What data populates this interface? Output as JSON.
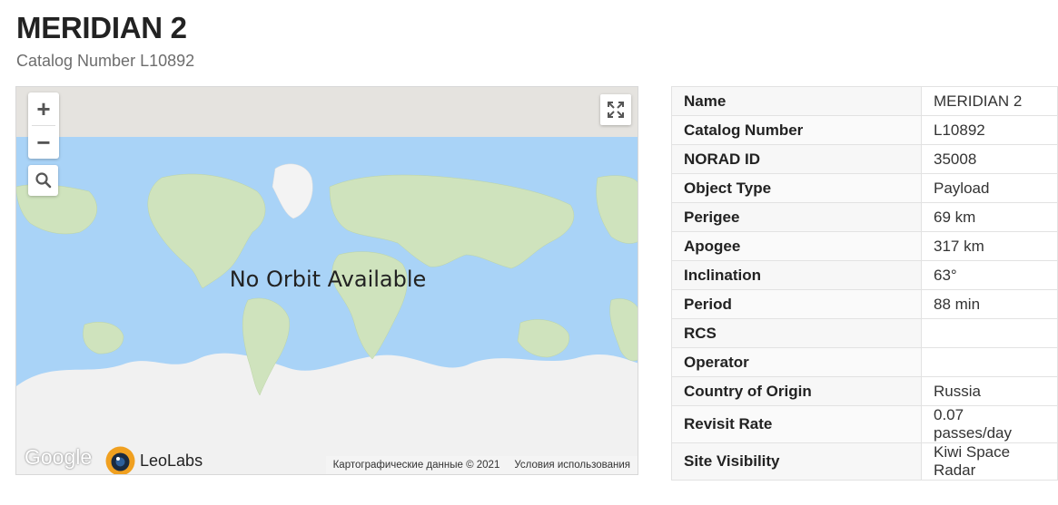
{
  "header": {
    "title": "MERIDIAN 2",
    "subtitle": "Catalog Number L10892"
  },
  "map": {
    "zoom_in": "+",
    "zoom_out": "−",
    "overlay_text": "No Orbit Available",
    "google_logo": "Google",
    "brand": "LeoLabs",
    "attribution": "Картографические данные © 2021",
    "terms": "Условия использования",
    "icons": {
      "search": "search-icon",
      "fullscreen": "fullscreen-icon",
      "brand": "leolabs-logo-icon"
    },
    "colors": {
      "water": "#a9d3f7",
      "land": "#cfe3bd",
      "ice": "#f1f1f1",
      "top_band": "#e5e3df"
    }
  },
  "details": [
    {
      "label": "Name",
      "value": "MERIDIAN 2"
    },
    {
      "label": "Catalog Number",
      "value": "L10892"
    },
    {
      "label": "NORAD ID",
      "value": "35008"
    },
    {
      "label": "Object Type",
      "value": "Payload"
    },
    {
      "label": "Perigee",
      "value": "69 km"
    },
    {
      "label": "Apogee",
      "value": "317 km"
    },
    {
      "label": "Inclination",
      "value": "63°"
    },
    {
      "label": "Period",
      "value": "88 min"
    },
    {
      "label": "RCS",
      "value": ""
    },
    {
      "label": "Operator",
      "value": ""
    },
    {
      "label": "Country of Origin",
      "value": "Russia"
    },
    {
      "label": "Revisit Rate",
      "value": "0.07 passes/day"
    },
    {
      "label": "Site Visibility",
      "value": "Kiwi Space Radar"
    }
  ]
}
